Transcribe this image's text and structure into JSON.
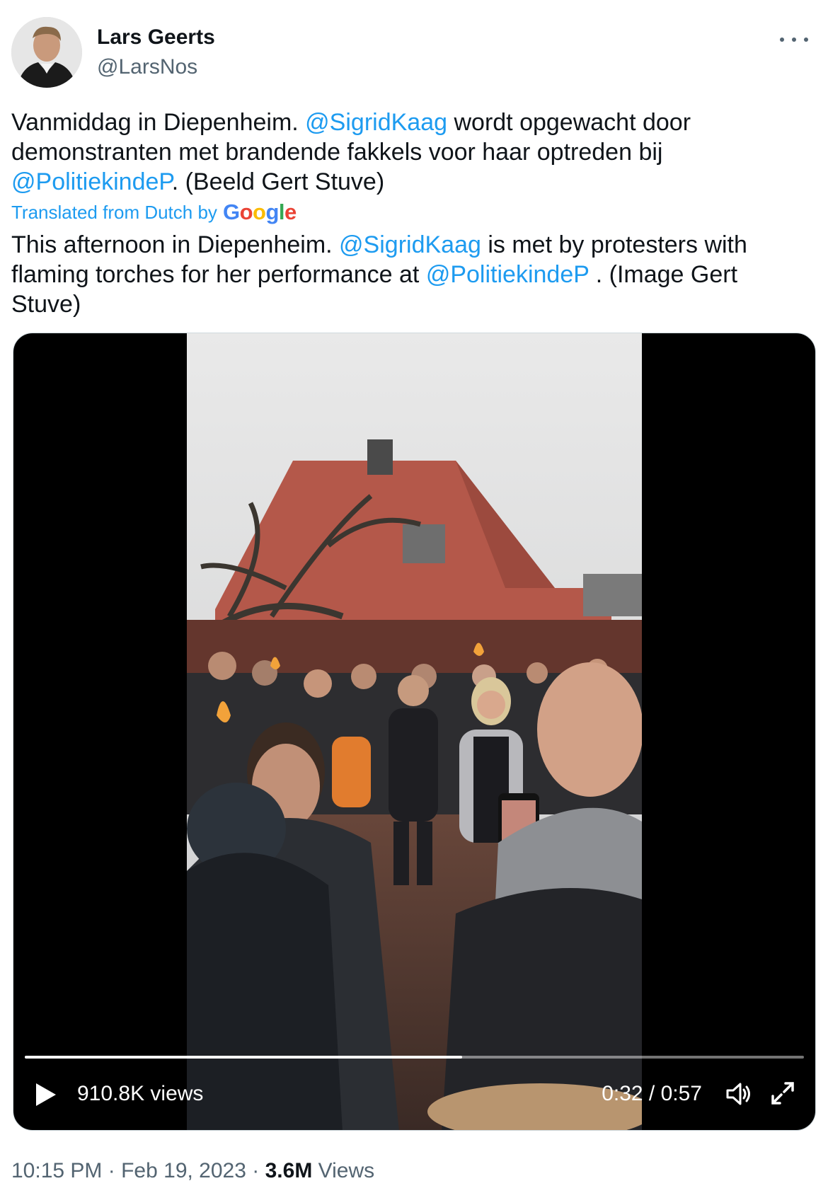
{
  "author": {
    "name": "Lars Geerts",
    "handle": "@LarsNos"
  },
  "tweet": {
    "original_parts": [
      "Vanmiddag in Diepenheim. ",
      "@SigridKaag",
      " wordt opgewacht door demonstranten met brandende fakkels voor haar optreden bij ",
      "@PolitiekindeP",
      ". (Beeld Gert Stuve)"
    ],
    "translated_label": "Translated from Dutch by",
    "translation_provider_letters": [
      "G",
      "o",
      "o",
      "g",
      "l",
      "e"
    ],
    "translation_parts": [
      "This afternoon in Diepenheim. ",
      "@SigridKaag",
      " is met by protesters with flaming torches for her performance at ",
      "@PolitiekindeP",
      " . (Image Gert Stuve)"
    ]
  },
  "video": {
    "views": "910.8K views",
    "time": "0:32 / 0:57",
    "progress_fraction": 0.561
  },
  "meta": {
    "time": "10:15 PM",
    "separator": "·",
    "date": "Feb 19, 2023",
    "views_count": "3.6M",
    "views_label": "Views"
  },
  "colors": {
    "accent": "#1d9bf0",
    "text": "#0f1419",
    "secondary": "#536471"
  },
  "icons": [
    "more-icon",
    "play-icon",
    "volume-icon",
    "fullscreen-icon"
  ]
}
